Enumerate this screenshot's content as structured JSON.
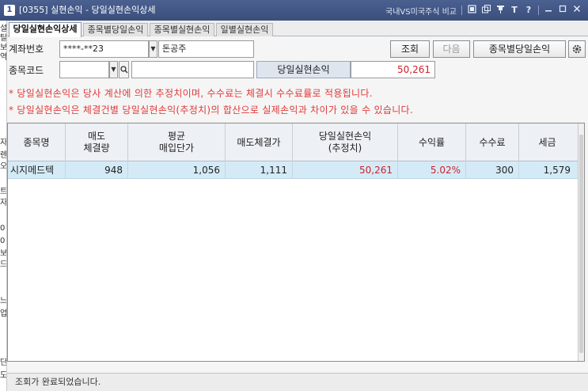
{
  "window": {
    "screen_no": "1",
    "title": "[0355] 실현손익 - 당일실현손익상세",
    "compare_link": "국내VS미국주식 비교"
  },
  "tabs": [
    {
      "label": "당일실현손익상세",
      "active": true
    },
    {
      "label": "종목별당일손익",
      "active": false
    },
    {
      "label": "종목별실현손익",
      "active": false
    },
    {
      "label": "일별실현손익",
      "active": false
    }
  ],
  "account": {
    "label": "계좌번호",
    "number": "****-**23",
    "owner": "돈공주"
  },
  "stock": {
    "label": "종목코드",
    "code": "",
    "name": ""
  },
  "buttons": {
    "query": "조회",
    "next": "다음",
    "by_stock": "종목별당일손익"
  },
  "summary": {
    "label": "당일실현손익",
    "value": "50,261"
  },
  "notes": [
    "* 당일실현손익은 당사 계산에 의한 추정치이며, 수수료는 체결시 수수료률로 적용됩니다.",
    "* 당일실현손익은 체결건별 당일실현손익(추정치)의 합산으로 실제손익과 차이가 있을 수 있습니다."
  ],
  "table": {
    "columns": [
      "종목명",
      "매도\n체결량",
      "평균\n매입단가",
      "매도체결가",
      "당일실현손익\n(추정치)",
      "수익률",
      "수수료",
      "세금"
    ],
    "rows": [
      [
        "시지메드텍",
        "948",
        "1,056",
        "1,111",
        "50,261",
        "5.02%",
        "300",
        "1,579"
      ]
    ]
  },
  "status": "조회가 완료되었습니다.",
  "background_window_glyphs": [
    "설",
    "탈",
    "보",
    "역",
    "자",
    "렌",
    "오",
    "트",
    "자",
    "0",
    "0",
    "보",
    "드",
    "느",
    "업",
    "단",
    "도"
  ],
  "colors": {
    "titlebar": "#3f5483",
    "accent_red": "#d0202a",
    "note_red": "#e03a3a",
    "row_highlight": "#d4ebf7"
  }
}
